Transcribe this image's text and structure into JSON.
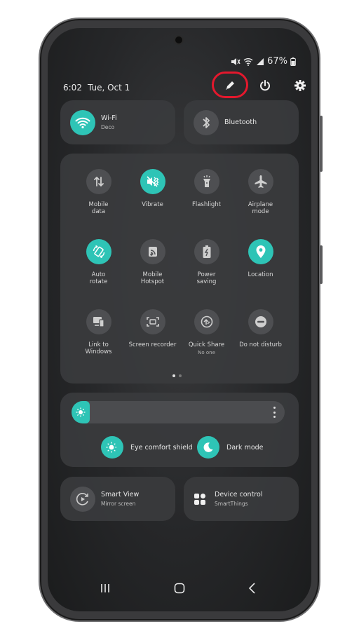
{
  "status_bar": {
    "battery": "67%"
  },
  "header": {
    "time": "6:02",
    "date": "Tue, Oct 1"
  },
  "colors": {
    "accent": "#2ec4b6",
    "highlight": "#e4182d",
    "tile_off": "#4e4f52"
  },
  "top_tiles": [
    {
      "title": "Wi-Fi",
      "subtitle": "Deco",
      "icon": "wifi-icon",
      "on": true
    },
    {
      "title": "Bluetooth",
      "subtitle": "",
      "icon": "bluetooth-icon",
      "on": false
    }
  ],
  "quick_settings": [
    {
      "label": "Mobile\ndata",
      "icon": "mobile-data-icon",
      "on": false
    },
    {
      "label": "Vibrate",
      "icon": "vibrate-icon",
      "on": true
    },
    {
      "label": "Flashlight",
      "icon": "flashlight-icon",
      "on": false
    },
    {
      "label": "Airplane\nmode",
      "icon": "airplane-icon",
      "on": false
    },
    {
      "label": "Auto\nrotate",
      "icon": "auto-rotate-icon",
      "on": true
    },
    {
      "label": "Mobile\nHotspot",
      "icon": "hotspot-icon",
      "on": false
    },
    {
      "label": "Power\nsaving",
      "icon": "power-saving-icon",
      "on": false
    },
    {
      "label": "Location",
      "icon": "location-icon",
      "on": true
    },
    {
      "label": "Link to\nWindows",
      "icon": "link-windows-icon",
      "on": false
    },
    {
      "label": "Screen recorder",
      "icon": "screen-recorder-icon",
      "on": false
    },
    {
      "label": "Quick Share",
      "sub": "No one",
      "icon": "quick-share-icon",
      "on": false
    },
    {
      "label": "Do not disturb",
      "icon": "do-not-disturb-icon",
      "on": false
    }
  ],
  "page_indicator": {
    "current": 1,
    "total": 2
  },
  "brightness": {
    "level": 0.08
  },
  "display_toggles": [
    {
      "label": "Eye comfort shield",
      "icon": "eye-comfort-icon"
    },
    {
      "label": "Dark mode",
      "icon": "dark-mode-icon"
    }
  ],
  "bottom_tiles": [
    {
      "title": "Smart View",
      "subtitle": "Mirror screen",
      "icon": "smart-view-icon"
    },
    {
      "title": "Device control",
      "subtitle": "SmartThings",
      "icon": "device-control-icon"
    }
  ]
}
